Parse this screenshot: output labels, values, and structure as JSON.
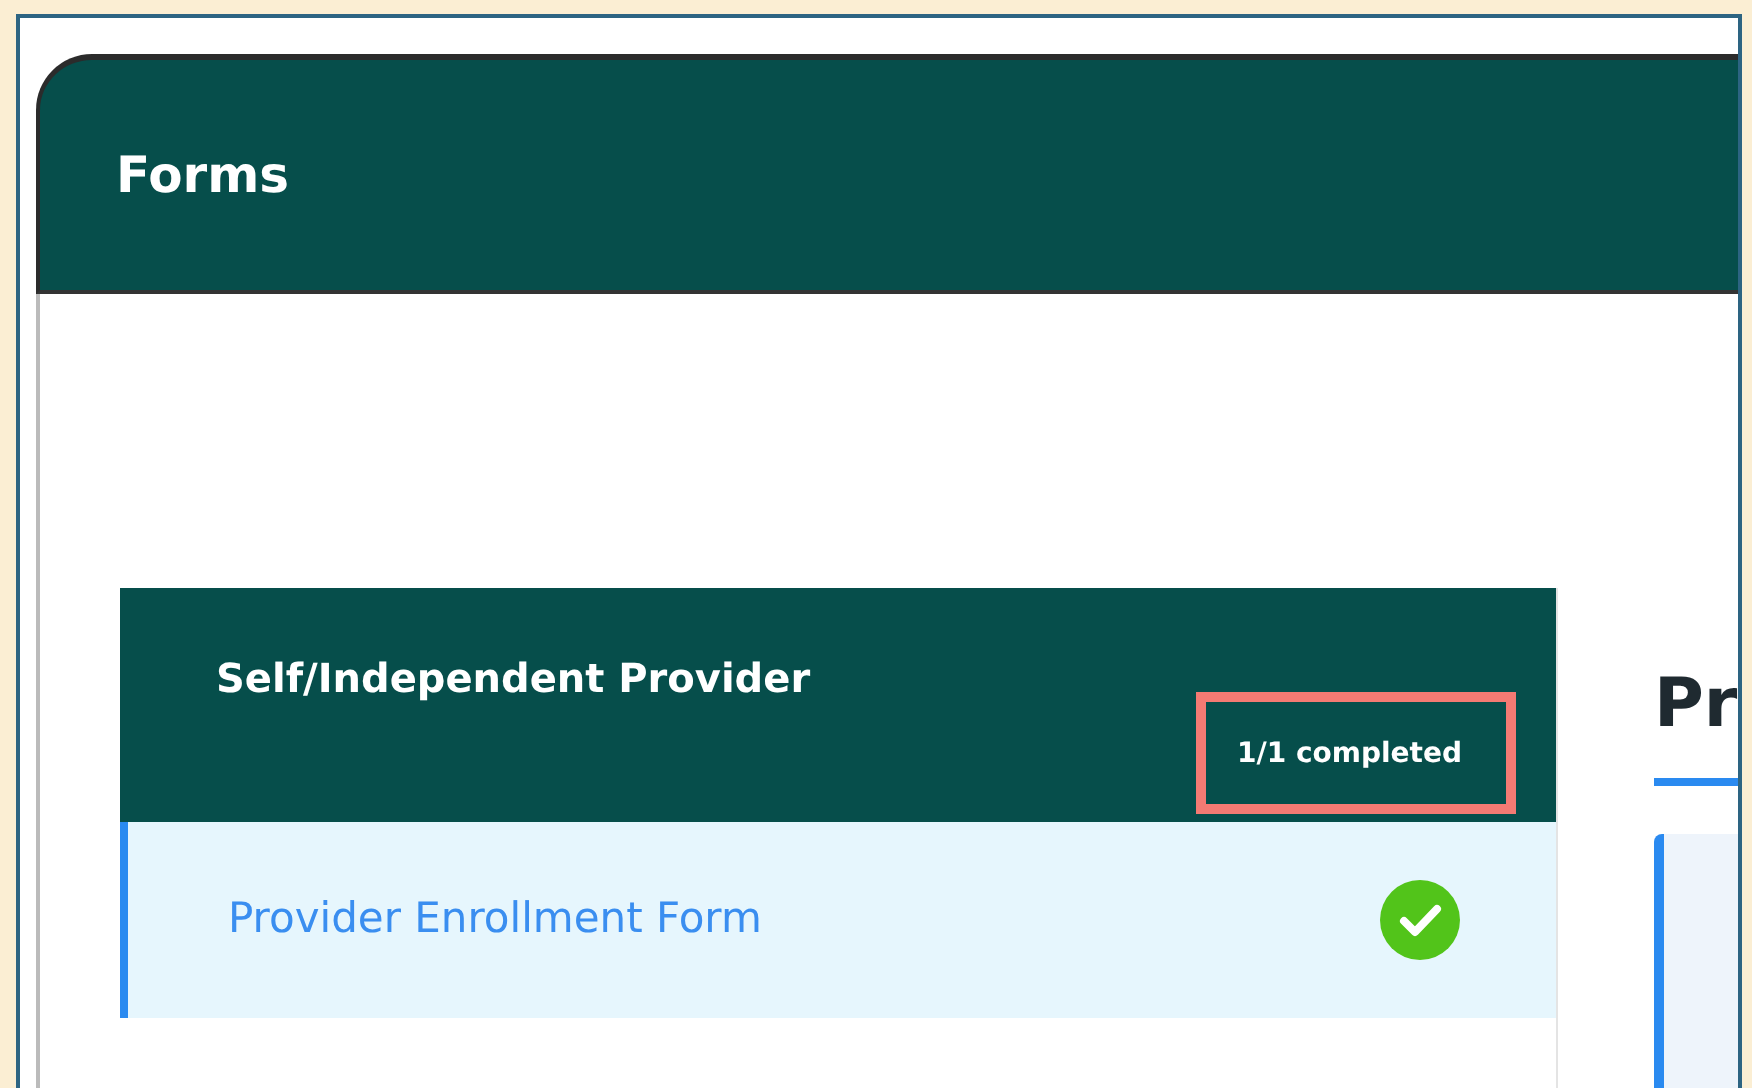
{
  "header": {
    "title": "Forms"
  },
  "section": {
    "title": "Self/Independent Provider",
    "progress": "1/1 completed",
    "progress_highlighted": true,
    "items": [
      {
        "label": "Provider Enrollment Form",
        "selected": true,
        "completed": true
      }
    ]
  },
  "detail": {
    "heading": "Pr"
  }
}
